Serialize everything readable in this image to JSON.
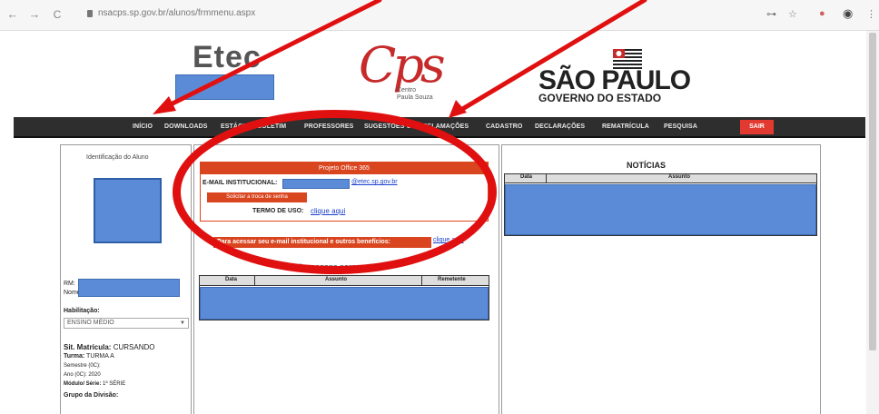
{
  "browser": {
    "back_icon": "arrow-left-icon",
    "forward_icon": "arrow-right-icon",
    "reload_icon": "reload-icon",
    "back_glyph": "←",
    "forward_glyph": "→",
    "reload_glyph": "C",
    "url": "nsacps.sp.gov.br/alunos/frmmenu.aspx",
    "key_glyph": "⊶",
    "star_glyph": "☆",
    "profile_glyph": "●",
    "menu_glyph": "⋮"
  },
  "header": {
    "etec": "Etec",
    "cps": "Cps",
    "cps_sub_1": "Centro",
    "cps_sub_2": "Paula Souza",
    "sp_title": "SÃO PAULO",
    "sp_sub": "GOVERNO DO ESTADO"
  },
  "nav": {
    "items": [
      "INÍCIO",
      "DOWNLOADS",
      "ESTÁGIO",
      "BOLETIM",
      "PROFESSORES",
      "SUGESTÕES OU RECLAMAÇÕES",
      "CADASTRO",
      "DECLARAÇÕES",
      "REMATRÍCULA",
      "PESQUISA"
    ],
    "exit": "SAIR"
  },
  "student": {
    "title": "Identificação do Aluno",
    "rm_label": "RM:",
    "name_label": "Nome:",
    "hab_label": "Habilitação:",
    "hab_value": "ENSINO MÉDIO",
    "status_label": "Sit. Matrícula:",
    "status_value": "CURSANDO",
    "class_label": "Turma:",
    "class_value": "TURMA A",
    "semester": "Semestre (0C):",
    "year": "Ano (0C): 2020",
    "module_label": "Módulo/ Série:",
    "module_value": "1ª SÉRIE",
    "group_label": "Grupo da Divisão:"
  },
  "office": {
    "title": "Projeto Office 365",
    "email_label": "E-MAIL INSTITUCIONAL:",
    "email_domain": "@etec.sp.gov.br",
    "password_button": "Solicitar a troca de senha",
    "terms_label": "TERMO DE USO:",
    "terms_link": "clique aqui"
  },
  "access": {
    "banner": "Para acessar seu e-mail institucional e outros benefícios:",
    "link": "clique aqui"
  },
  "messages": {
    "title": "Mensagens para o aluno",
    "columns": [
      "Data",
      "Assunto",
      "Remetente"
    ]
  },
  "news": {
    "title": "NOTÍCIAS",
    "columns": [
      "Data",
      "Assunto"
    ]
  },
  "colors": {
    "annotation_red": "#e01010",
    "brand_red": "#d9451f",
    "nav_dark": "#2e2e2e",
    "redaction_blue": "#5b8bd6"
  }
}
